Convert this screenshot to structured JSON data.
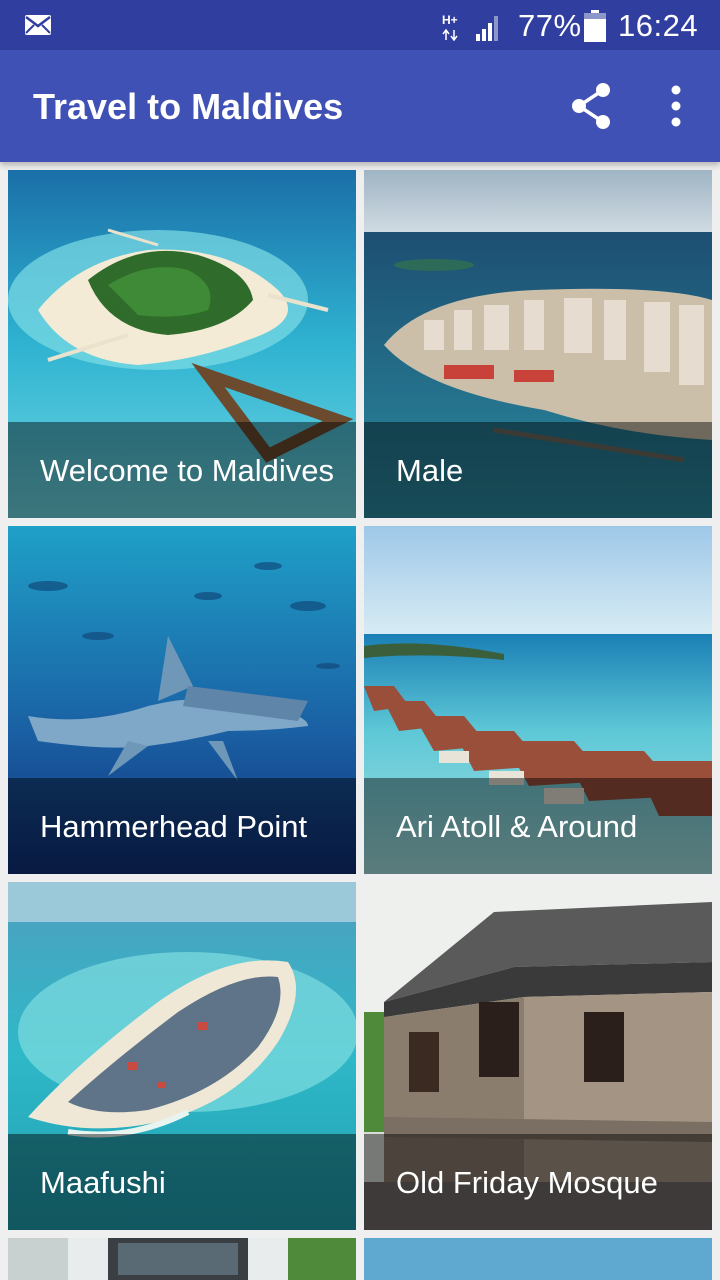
{
  "status_bar": {
    "battery": "77%",
    "time": "16:24",
    "network": "H+"
  },
  "app_bar": {
    "title": "Travel to Maldives",
    "share_icon": "share-icon",
    "more_icon": "more-vertical-icon"
  },
  "tiles": [
    {
      "label": "Welcome to Maldives"
    },
    {
      "label": "Male"
    },
    {
      "label": "Hammerhead Point"
    },
    {
      "label": "Ari Atoll & Around"
    },
    {
      "label": "Maafushi"
    },
    {
      "label": "Old Friday Mosque"
    }
  ],
  "colors": {
    "status_bar": "#303f9f",
    "app_bar": "#3f51b5",
    "background": "#efefef"
  }
}
